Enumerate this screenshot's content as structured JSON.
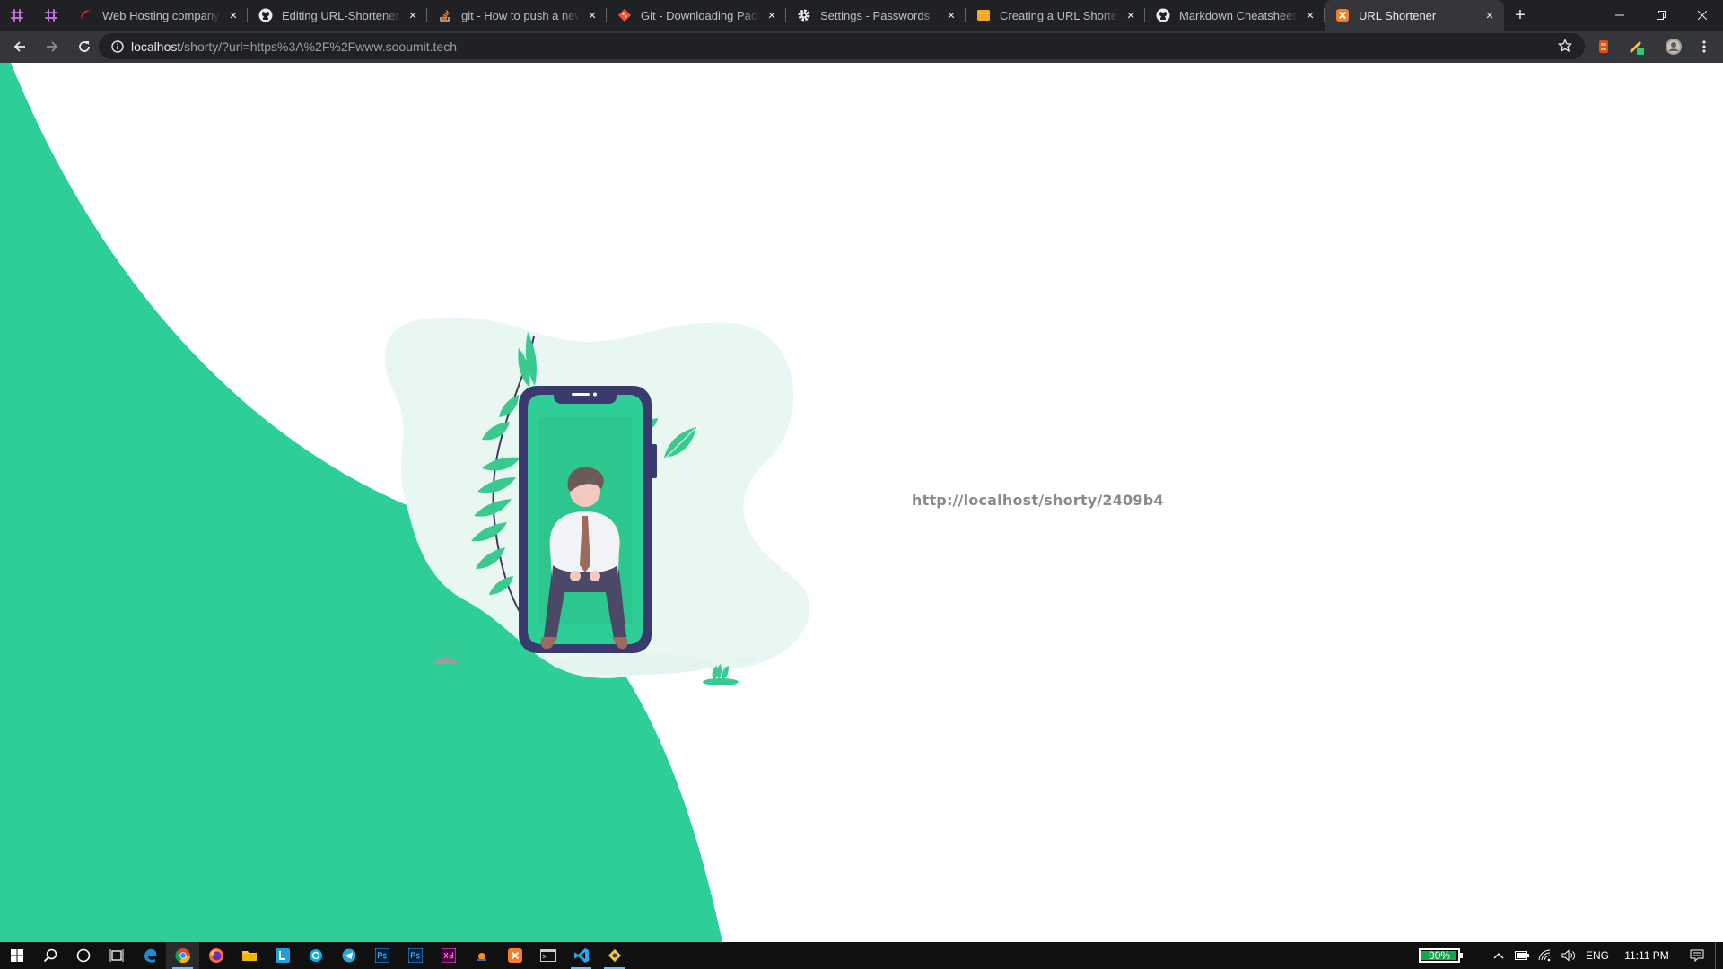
{
  "browser": {
    "tabs": [
      {
        "title": "Web Hosting company in",
        "favicon": "hosting-swoosh-icon"
      },
      {
        "title": "Editing URL-Shortener/RE",
        "favicon": "github-icon"
      },
      {
        "title": "git - How to push a new in",
        "favicon": "stackoverflow-icon"
      },
      {
        "title": "Git - Downloading Packag",
        "favicon": "git-icon"
      },
      {
        "title": "Settings - Passwords",
        "favicon": "gear-icon"
      },
      {
        "title": "Creating a URL Shortener",
        "favicon": "doc-icon"
      },
      {
        "title": "Markdown Cheatsheet · a",
        "favicon": "github-icon"
      },
      {
        "title": "URL Shortener",
        "favicon": "xampp-icon",
        "active": true
      }
    ],
    "address": {
      "host": "localhost",
      "path": "/shorty/?url=https%3A%2F%2Fwww.sooumit.tech"
    }
  },
  "page": {
    "short_url": "http://localhost/shorty/2409b4",
    "accent_color": "#2ecf96"
  },
  "taskbar": {
    "battery": "90%",
    "language": "ENG",
    "time": "11:11 PM"
  }
}
